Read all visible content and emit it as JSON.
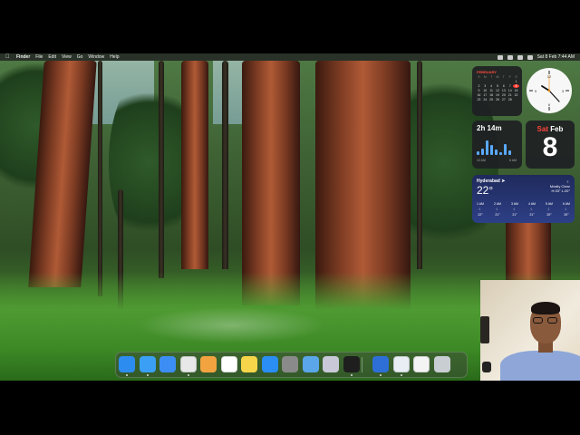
{
  "menubar": {
    "apple_icon": "apple-logo-icon",
    "menus": [
      "Finder",
      "File",
      "Edit",
      "View",
      "Go",
      "Window",
      "Help"
    ],
    "clock": "Sat 8 Feb  7:44 AM",
    "status_icons": [
      "battery-icon",
      "wifi-icon",
      "search-icon",
      "control-center-icon",
      "siri-icon"
    ]
  },
  "widgets": {
    "calendar": {
      "month": "FEBRUARY",
      "weekday_headers": [
        "S",
        "M",
        "T",
        "W",
        "T",
        "F",
        "S"
      ],
      "days": [
        "",
        "",
        "",
        "",
        "",
        "",
        "1",
        "2",
        "3",
        "4",
        "5",
        "6",
        "7",
        "8",
        "9",
        "10",
        "11",
        "12",
        "13",
        "14",
        "15",
        "16",
        "17",
        "18",
        "19",
        "20",
        "21",
        "22",
        "23",
        "24",
        "25",
        "26",
        "27",
        "28",
        ""
      ],
      "today": "8"
    },
    "clock": {
      "icon": "analog-clock-icon"
    },
    "screen_time": {
      "value": "2h 14m",
      "axis_left": "12 AM",
      "axis_right": "6 AM",
      "bar_levels": [
        0.2,
        0.35,
        0.8,
        0.55,
        0.3,
        0.15,
        0.6,
        0.25
      ]
    },
    "date": {
      "day_name": "Sat",
      "month": "Feb",
      "day": "8"
    },
    "weather": {
      "city": "Hyderabad",
      "temp": "22°",
      "condition": "Mostly Clear",
      "hi_lo": "H:33° L:20°",
      "hours": [
        {
          "time": "1 AM",
          "temp": "22°"
        },
        {
          "time": "2 AM",
          "temp": "21°"
        },
        {
          "time": "3 AM",
          "temp": "21°"
        },
        {
          "time": "4 AM",
          "temp": "21°"
        },
        {
          "time": "5 AM",
          "temp": "20°"
        },
        {
          "time": "6 AM",
          "temp": "20°"
        }
      ]
    }
  },
  "dock": {
    "apps": [
      {
        "name": "Finder",
        "icon": "finder-icon",
        "color": "#2d8cf0",
        "running": true
      },
      {
        "name": "Safari",
        "icon": "safari-icon",
        "color": "#3ba0f5",
        "running": true
      },
      {
        "name": "Mail",
        "icon": "mail-icon",
        "color": "#3d8ef4",
        "running": false
      },
      {
        "name": "Chrome",
        "icon": "chrome-icon",
        "color": "#e8e8e8",
        "running": true
      },
      {
        "name": "Photos",
        "icon": "photos-icon",
        "color": "#f2a340",
        "running": false
      },
      {
        "name": "Calendar",
        "icon": "calendar-icon",
        "color": "#ffffff",
        "running": false
      },
      {
        "name": "Notes",
        "icon": "notes-icon",
        "color": "#f7d54a",
        "running": false
      },
      {
        "name": "App Store",
        "icon": "app-store-icon",
        "color": "#2a8ef5",
        "running": false
      },
      {
        "name": "System Settings",
        "icon": "settings-icon",
        "color": "#8a8a8a",
        "running": false
      },
      {
        "name": "Preview",
        "icon": "preview-icon",
        "color": "#5aa6e8",
        "running": false
      },
      {
        "name": "Launchpad",
        "icon": "launchpad-icon",
        "color": "#c8c8d8",
        "running": false
      },
      {
        "name": "Terminal",
        "icon": "terminal-icon",
        "color": "#1e1e1e",
        "running": true
      }
    ],
    "recent": [
      {
        "name": "QuickTime",
        "icon": "quicktime-icon",
        "color": "#2d6fd6",
        "running": true
      },
      {
        "name": "Screenshot",
        "icon": "screenshot-icon",
        "color": "#e8eef4",
        "running": true
      },
      {
        "name": "TextEdit",
        "icon": "textedit-icon",
        "color": "#f4f4f4",
        "running": false
      }
    ],
    "trash": {
      "name": "Trash",
      "icon": "trash-icon",
      "color": "#c9ced3"
    }
  }
}
